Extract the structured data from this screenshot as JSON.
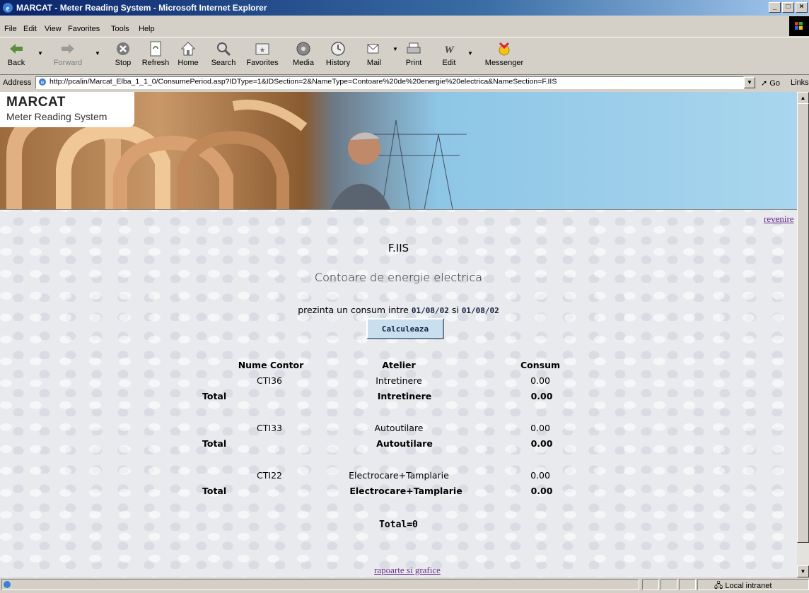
{
  "window": {
    "title": "MARCAT - Meter Reading System - Microsoft Internet Explorer",
    "controls": [
      "_",
      "□",
      "×"
    ]
  },
  "menu": [
    "File",
    "Edit",
    "View",
    "Favorites",
    "Tools",
    "Help"
  ],
  "toolbar": {
    "back": "Back",
    "forward": "Forward",
    "stop": "Stop",
    "refresh": "Refresh",
    "home": "Home",
    "search": "Search",
    "favorites": "Favorites",
    "media": "Media",
    "history": "History",
    "mail": "Mail",
    "print": "Print",
    "edit": "Edit",
    "messenger": "Messenger"
  },
  "address": {
    "label": "Address",
    "url": "http://pcalin/Marcat_Elba_1_1_0/ConsumePeriod.asp?IDType=1&IDSection=2&NameType=Contoare%20de%20energie%20electrica&NameSection=F.IIS",
    "go": "Go",
    "links": "Links"
  },
  "banner": {
    "logo_title": "MARCAT",
    "logo_subtitle": "Meter Reading System"
  },
  "page": {
    "back_link": "revenire",
    "section": "F.IIS",
    "type": "Contoare de energie electrica",
    "period_prefix": "prezinta un consum intre",
    "date_from": "01/08/02",
    "period_and": "si",
    "date_to": "01/08/02",
    "calc_button": "Calculeaza",
    "reports_link": "rapoarte si grafice",
    "grand_total": "Total=0"
  },
  "table": {
    "headers": [
      "Nume Contor",
      "Atelier",
      "Consum"
    ],
    "groups": [
      {
        "meter": "CTI36",
        "workshop": "Intretinere",
        "consum": "0.00",
        "total_label": "Total",
        "total_workshop": "Intretinere",
        "total_consum": "0.00"
      },
      {
        "meter": "CTI33",
        "workshop": "Autoutilare",
        "consum": "0.00",
        "total_label": "Total",
        "total_workshop": "Autoutilare",
        "total_consum": "0.00"
      },
      {
        "meter": "CTI22",
        "workshop": "Electrocare+Tamplarie",
        "consum": "0.00",
        "total_label": "Total",
        "total_workshop": "Electrocare+Tamplarie",
        "total_consum": "0.00"
      }
    ]
  },
  "status": {
    "zone": "Local intranet"
  }
}
